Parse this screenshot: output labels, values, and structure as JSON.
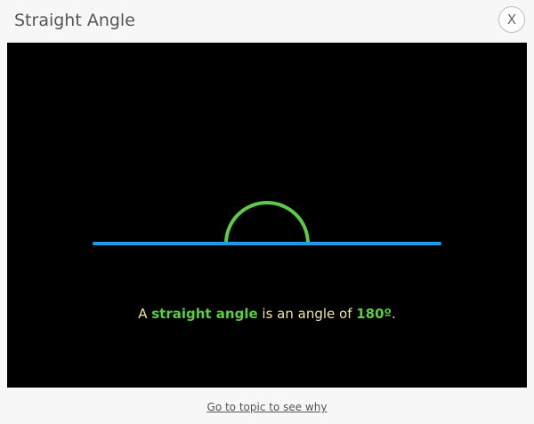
{
  "dialog": {
    "title": "Straight Angle",
    "close_label": "X",
    "footer_link": "Go to topic to see why"
  },
  "caption": {
    "part1": "A ",
    "term": "straight angle",
    "part2": " is an angle of ",
    "value": "180º",
    "part3": "."
  },
  "colors": {
    "line": "#1e9be9",
    "arc": "#5ec94a",
    "caption_text": "#f0e4a8",
    "highlight": "#5ec94a",
    "stage_bg": "#000000"
  }
}
